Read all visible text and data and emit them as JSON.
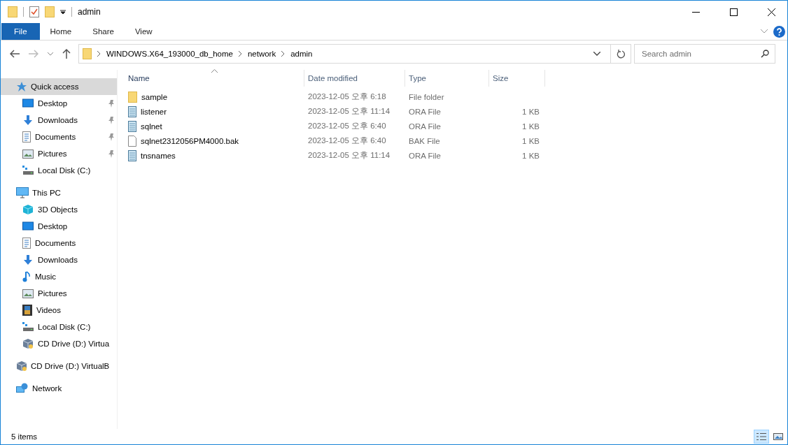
{
  "window": {
    "title": "admin"
  },
  "ribbon": {
    "tabs": [
      {
        "label": "File",
        "kind": "file",
        "selected": false
      },
      {
        "label": "Home",
        "kind": "tab",
        "selected": false
      },
      {
        "label": "Share",
        "kind": "tab",
        "selected": false
      },
      {
        "label": "View",
        "kind": "tab",
        "selected": false
      }
    ]
  },
  "address": {
    "segments": [
      "WINDOWS.X64_193000_db_home",
      "network",
      "admin"
    ]
  },
  "search": {
    "placeholder": "Search admin"
  },
  "sidebar": {
    "items": [
      {
        "label": "Quick access",
        "kind": "star",
        "selected": true,
        "children": [
          {
            "label": "Desktop",
            "kind": "desktop",
            "pinned": true,
            "selected": false
          },
          {
            "label": "Downloads",
            "kind": "download",
            "pinned": true,
            "selected": false
          },
          {
            "label": "Documents",
            "kind": "document",
            "pinned": true,
            "selected": false
          },
          {
            "label": "Pictures",
            "kind": "picture",
            "pinned": true,
            "selected": false
          },
          {
            "label": "Local Disk (C:)",
            "kind": "disk",
            "pinned": false,
            "selected": false
          }
        ]
      },
      {
        "label": "This PC",
        "kind": "pc",
        "selected": false,
        "children": [
          {
            "label": "3D Objects",
            "kind": "cube",
            "pinned": false,
            "selected": false
          },
          {
            "label": "Desktop",
            "kind": "desktop",
            "pinned": false,
            "selected": false
          },
          {
            "label": "Documents",
            "kind": "document",
            "pinned": false,
            "selected": false
          },
          {
            "label": "Downloads",
            "kind": "download",
            "pinned": false,
            "selected": false
          },
          {
            "label": "Music",
            "kind": "music",
            "pinned": false,
            "selected": false
          },
          {
            "label": "Pictures",
            "kind": "picture",
            "pinned": false,
            "selected": false
          },
          {
            "label": "Videos",
            "kind": "video",
            "pinned": false,
            "selected": false
          },
          {
            "label": "Local Disk (C:)",
            "kind": "disk",
            "pinned": false,
            "selected": false
          },
          {
            "label": "CD Drive (D:) Virtua",
            "kind": "cd",
            "pinned": false,
            "selected": false
          }
        ]
      },
      {
        "label": "CD Drive (D:) VirtualB",
        "kind": "cd",
        "selected": false
      },
      {
        "label": "Network",
        "kind": "network",
        "selected": false
      }
    ]
  },
  "table": {
    "columns": [
      {
        "label": "Name",
        "sorted": true
      },
      {
        "label": "Date modified",
        "sorted": false
      },
      {
        "label": "Type",
        "sorted": false
      },
      {
        "label": "Size",
        "sorted": false
      }
    ],
    "rows": [
      {
        "name": "sample",
        "kind": "folder",
        "date": "2023-12-05 오후 6:18",
        "type": "File folder"
      },
      {
        "name": "listener",
        "kind": "ora",
        "date": "2023-12-05 오후 11:14",
        "type": "ORA File",
        "size": "1 KB"
      },
      {
        "name": "sqlnet",
        "kind": "ora",
        "date": "2023-12-05 오후 6:40",
        "type": "ORA File",
        "size": "1 KB"
      },
      {
        "name": "sqlnet2312056PM4000.bak",
        "kind": "bak",
        "date": "2023-12-05 오후 6:40",
        "type": "BAK File",
        "size": "1 KB"
      },
      {
        "name": "tnsnames",
        "kind": "ora",
        "date": "2023-12-05 오후 11:14",
        "type": "ORA File",
        "size": "1 KB"
      }
    ]
  },
  "status_bar": {
    "count": "5 items",
    "views": [
      {
        "kind": "details",
        "selected": true
      },
      {
        "kind": "large",
        "selected": false
      }
    ]
  }
}
